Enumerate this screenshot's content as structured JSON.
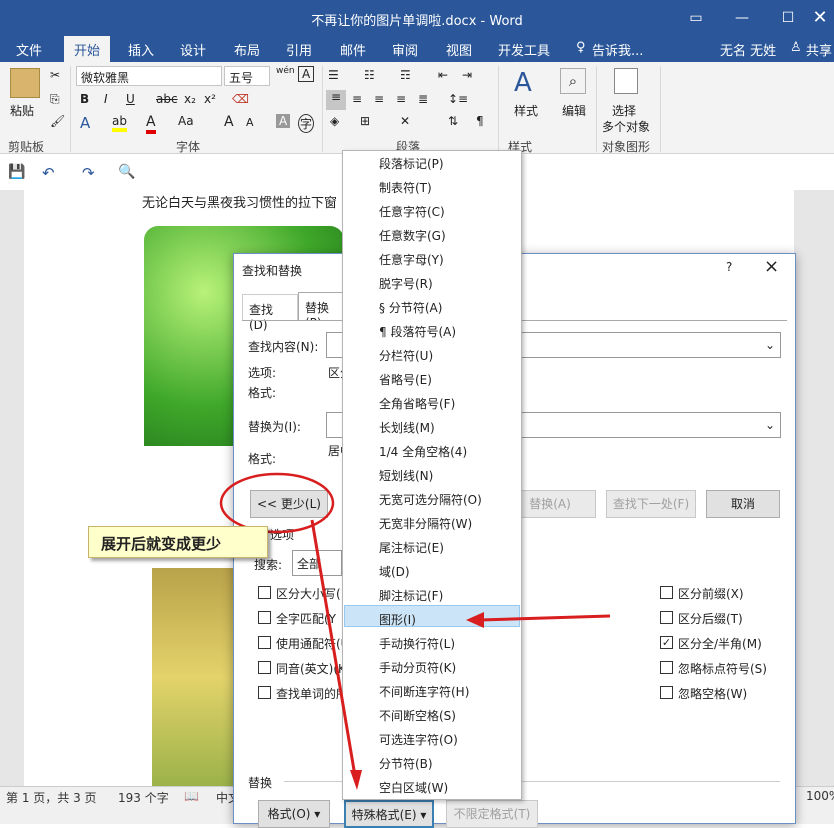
{
  "window": {
    "title": "不再让你的图片单调啦.docx - Word",
    "ribbon_display_icon": "ribbon-display-icon",
    "minimize_icon": "minimize-icon",
    "maximize_icon": "maximize-icon",
    "close_icon": "close-icon"
  },
  "tabs": [
    "文件",
    "开始",
    "插入",
    "设计",
    "布局",
    "引用",
    "邮件",
    "审阅",
    "视图",
    "开发工具"
  ],
  "tellme": "告诉我...",
  "user": "无名 无姓",
  "share": "共享",
  "ribbon": {
    "paste": "粘贴",
    "clipboard": "剪贴板",
    "font_name": "微软雅黑",
    "font_size": "五号",
    "font_group": "字体",
    "para_group": "段落",
    "style": "样式",
    "style_group": "样式",
    "edit": "编辑",
    "select": "选择",
    "multi": "多个对象",
    "select_group": "对象图形",
    "bold": "B",
    "italic": "I",
    "underline": "U",
    "strike": "abc",
    "sub": "x₂",
    "sup": "x²",
    "aa": "Aa",
    "grow": "A",
    "shrink": "A",
    "wen": "wén",
    "fontA": "A"
  },
  "doc": {
    "line1": "无论白天与黑夜我习惯性的拉下窗"
  },
  "status": {
    "page": "第 1 页，共 3 页",
    "words": "193 个字",
    "lang": "中文",
    "zoom": "100%"
  },
  "dialog": {
    "title": "查找和替换",
    "help": "?",
    "close": "×",
    "tab_find": "查找(D)",
    "tab_replace": "替换(P)",
    "find_label": "查找内容(N):",
    "options_label": "选项:",
    "options_value": "区分",
    "format_label": "格式:",
    "replace_label": "替换为(I):",
    "replace_format_label": "格式:",
    "replace_format_value": "居中",
    "less_btn": "<< 更少(L)",
    "replace_btn": "替换(A)",
    "findnext_btn": "查找下一处(F)",
    "cancel_btn": "取消",
    "search_options": "选项",
    "search_label": "搜索:",
    "search_value": "全部",
    "checks_left": [
      {
        "label": "区分大小写(",
        "checked": false
      },
      {
        "label": "全字匹配(Y",
        "checked": false
      },
      {
        "label": "使用通配符(U",
        "checked": false
      },
      {
        "label": "同音(英文)(K",
        "checked": false
      },
      {
        "label": "查找单词的所",
        "checked": false
      }
    ],
    "checks_right": [
      {
        "label": "区分前缀(X)",
        "checked": false
      },
      {
        "label": "区分后缀(T)",
        "checked": false
      },
      {
        "label": "区分全/半角(M)",
        "checked": true
      },
      {
        "label": "忽略标点符号(S)",
        "checked": false
      },
      {
        "label": "忽略空格(W)",
        "checked": false
      }
    ],
    "replace_section": "替换",
    "format_btn": "格式(O)",
    "special_btn": "特殊格式(E)",
    "nolimit_btn": "不限定格式(T)"
  },
  "menu": {
    "items": [
      "段落标记(P)",
      "制表符(T)",
      "任意字符(C)",
      "任意数字(G)",
      "任意字母(Y)",
      "脱字号(R)",
      "§ 分节符(A)",
      "¶ 段落符号(A)",
      "分栏符(U)",
      "省略号(E)",
      "全角省略号(F)",
      "长划线(M)",
      "1/4 全角空格(4)",
      "短划线(N)",
      "无宽可选分隔符(O)",
      "无宽非分隔符(W)",
      "尾注标记(E)",
      "域(D)",
      "脚注标记(F)",
      "图形(I)",
      "手动换行符(L)",
      "手动分页符(K)",
      "不间断连字符(H)",
      "不间断空格(S)",
      "可选连字符(O)",
      "分节符(B)",
      "空白区域(W)"
    ],
    "highlighted": "图形(I)"
  },
  "callout": "展开后就变成更少"
}
